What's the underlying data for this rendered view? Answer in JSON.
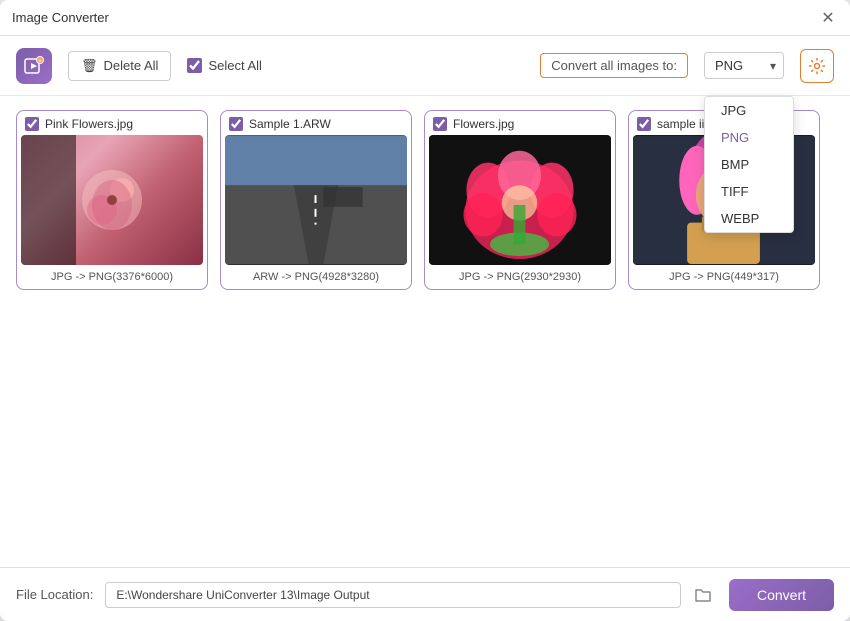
{
  "window": {
    "title": "Image Converter"
  },
  "toolbar": {
    "delete_all_label": "Delete All",
    "select_all_label": "Select All",
    "convert_label": "Convert all images to:",
    "selected_format": "PNG",
    "settings_icon": "⚙"
  },
  "formats": {
    "options": [
      "JPG",
      "PNG",
      "BMP",
      "TIFF",
      "WEBP"
    ]
  },
  "images": [
    {
      "filename": "Pink Flowers.jpg",
      "checked": true,
      "info": "JPG -> PNG(3376*6000)",
      "thumb_type": "pink"
    },
    {
      "filename": "Sample 1.ARW",
      "checked": true,
      "info": "ARW -> PNG(4928*3280)",
      "thumb_type": "road"
    },
    {
      "filename": "Flowers.jpg",
      "checked": true,
      "info": "JPG -> PNG(2930*2930)",
      "thumb_type": "flowers"
    },
    {
      "filename": "sample ii",
      "checked": true,
      "info": "JPG -> PNG(449*317)",
      "thumb_type": "person"
    }
  ],
  "status_bar": {
    "file_location_label": "File Location:",
    "file_location_value": "E:\\Wondershare UniConverter 13\\Image Output",
    "convert_button_label": "Convert"
  }
}
